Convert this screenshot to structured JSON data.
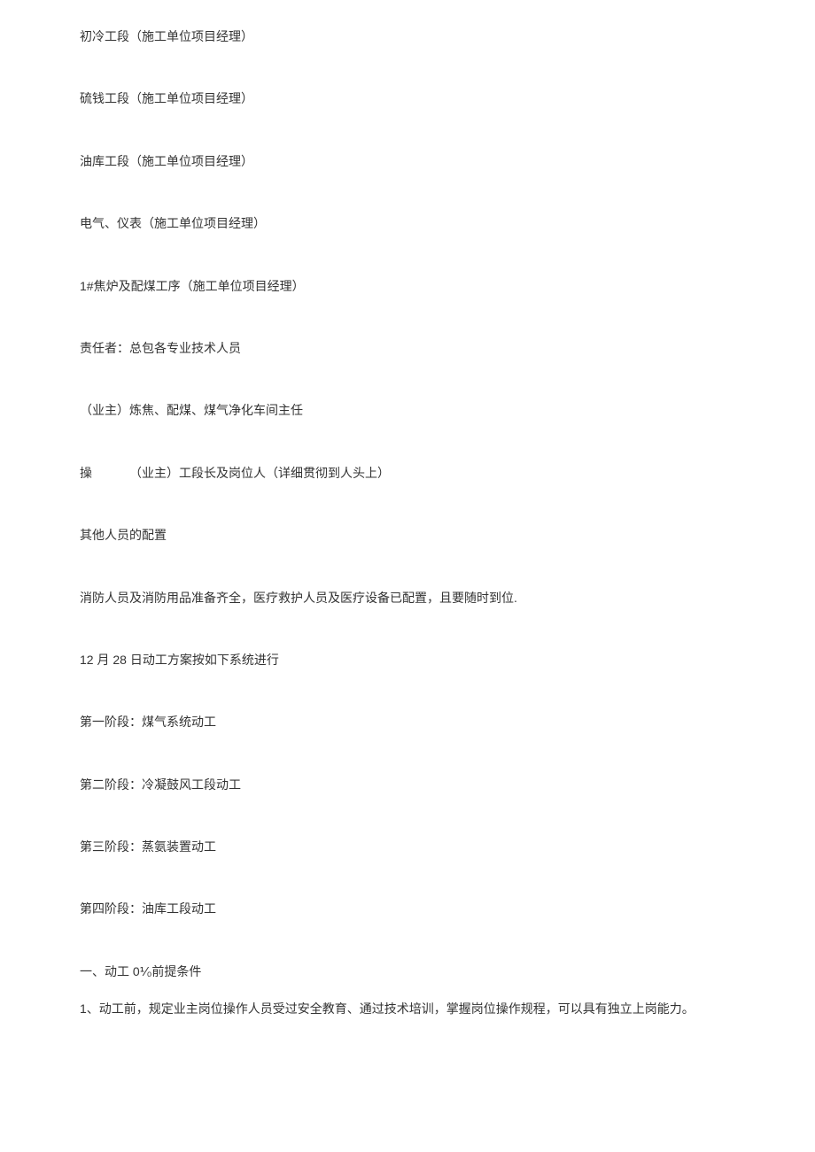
{
  "lines": {
    "l1": "初冷工段（施工单位项目经理）",
    "l2": "硫钱工段（施工单位项目经理）",
    "l3": "油库工段（施工单位项目经理）",
    "l4": "电气、仪表（施工单位项目经理）",
    "l5": "1#焦炉及配煤工序（施工单位项目经理）",
    "l6": "责任者：总包各专业技术人员",
    "l7": "（业主）炼焦、配煤、煤气净化车间主任",
    "l8a": "操",
    "l8b": "（业主）工段长及岗位人（详细贯彻到人头上）",
    "l9": "其他人员的配置",
    "l10": "消防人员及消防用品准备齐全，医疗救护人员及医疗设备已配置，且要随时到位.",
    "l11": "12 月 28 日动工方案按如下系统进行",
    "l12": "第一阶段：煤气系统动工",
    "l13": "第二阶段：冷凝鼓风工段动工",
    "l14": "第三阶段：蒸氨装置动工",
    "l15": "第四阶段：油库工段动工",
    "l16": "一、动工 0⅟₀前提条件",
    "l17": "1、动工前，规定业主岗位操作人员受过安全教育、通过技术培训，掌握岗位操作规程，可以具有独立上岗能力。"
  }
}
